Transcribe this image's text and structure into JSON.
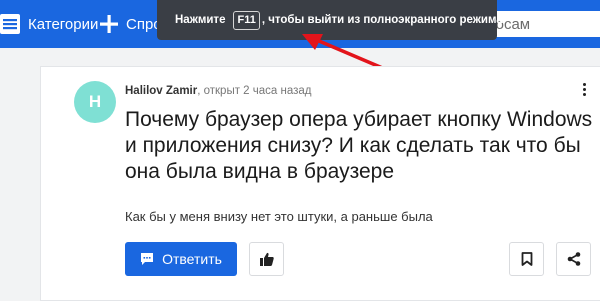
{
  "nav": {
    "categories_label": "Категории",
    "ask_label": "Спросить"
  },
  "search": {
    "text": "вопросам"
  },
  "fullscreen_notice": {
    "before": "Нажмите",
    "key": "F11",
    "after": ", чтобы выйти из полноэкранного режима"
  },
  "question": {
    "author": "Halilov Zamir",
    "meta": ", открыт 2 часа назад",
    "avatar_letter": "H",
    "title": "Почему браузер опера убирает кнопку Windows и приложения снизу? И как сделать так что бы она была видна в браузере",
    "body": "Как бы у меня внизу нет это штуки, а раньше была"
  },
  "actions": {
    "answer_label": "Ответить"
  },
  "colors": {
    "brand": "#1a67e0",
    "avatar": "#7fe0d4",
    "annotation_arrow": "#e3141b"
  },
  "icons": [
    "grid-icon",
    "plus-icon",
    "comment-icon",
    "thumbs-up-icon",
    "bookmark-icon",
    "share-icon",
    "more-vertical-icon"
  ]
}
